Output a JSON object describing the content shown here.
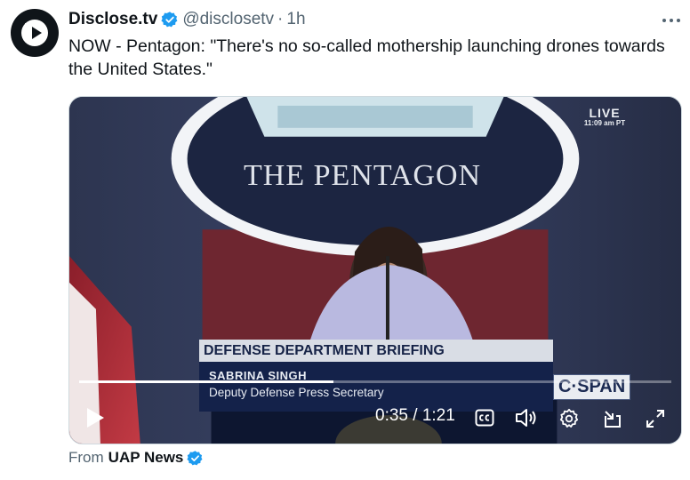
{
  "post": {
    "author_name": "Disclose.tv",
    "handle": "@disclosetv",
    "separator": "·",
    "time": "1h",
    "text": "NOW - Pentagon: \"There's no so-called mothership launching drones towards the United States.\""
  },
  "video": {
    "live_label": "LIVE",
    "live_time": "11:09 am PT",
    "backdrop_text": "THE PENTAGON",
    "chyron_title": "DEFENSE DEPARTMENT BRIEFING",
    "speaker_name": "SABRINA SINGH",
    "speaker_title": "Deputy Defense Press Secretary",
    "network_logo": "C·SPAN",
    "current_time": "0:35",
    "time_separator": "/",
    "duration": "1:21",
    "progress": 0.43,
    "icons": [
      "play-icon",
      "captions-icon",
      "volume-icon",
      "settings-icon",
      "pip-icon",
      "fullscreen-icon"
    ]
  },
  "attribution": {
    "prefix": "From",
    "source": "UAP News"
  },
  "colors": {
    "verified": "#1d9bf0",
    "secondary_text": "#536471",
    "primary_text": "#0f1419"
  }
}
